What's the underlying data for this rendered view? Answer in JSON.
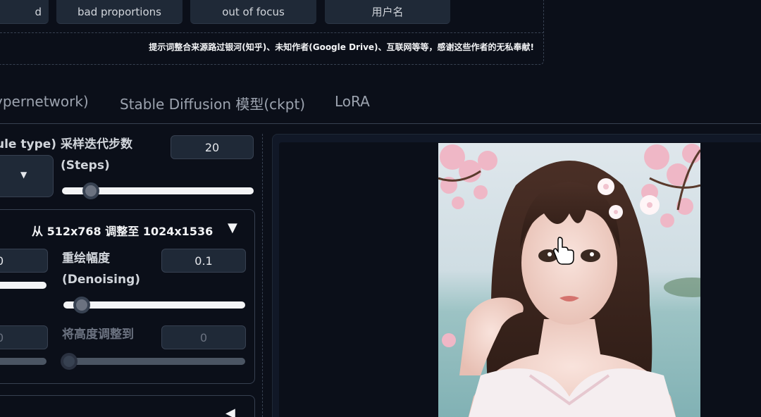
{
  "prompt_tags": [
    "d",
    "bad proportions",
    "out of focus",
    "用户名"
  ],
  "credit_note": "提示词整合来源路过银河(知乎)、未知作者(Google Drive)、互联网等等，感谢这些作者的无私奉献!",
  "tabs": [
    "ypernetwork)",
    "Stable Diffusion 模型(ckpt)",
    "LoRA"
  ],
  "settings": {
    "schedule_label": "ule type)",
    "steps_label_line1": "采样迭代步数",
    "steps_label_line2": "(Steps)",
    "steps_value": "20",
    "steps_fraction": 0.15,
    "hires_title": "从 512x768  调整至 1024x1536",
    "hires_toggle": "▼",
    "upscale_value": "0",
    "denoise_label_line1": "重绘幅度",
    "denoise_label_line2": "(Denoising)",
    "denoise_value": "0.1",
    "denoise_fraction": 0.1,
    "height_label": "将高度调整到",
    "height_value": "0",
    "width_value_partial": "0",
    "collapsed_toggle": "◀"
  },
  "colors": {
    "background": "#0b0f19",
    "panel": "#1f2937",
    "border": "#374151",
    "text": "#d1d5db"
  }
}
